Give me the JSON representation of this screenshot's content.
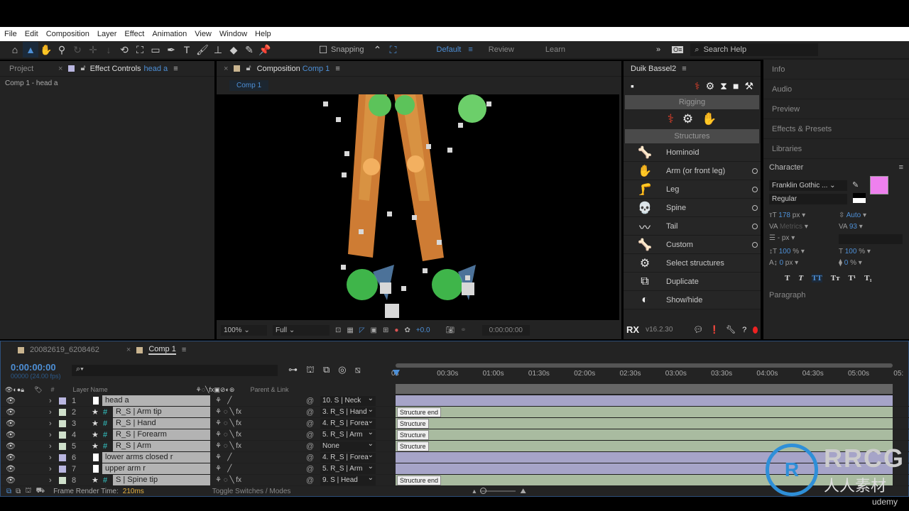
{
  "menu": [
    "File",
    "Edit",
    "Composition",
    "Layer",
    "Effect",
    "Animation",
    "View",
    "Window",
    "Help"
  ],
  "toolbar": {
    "snapping": "Snapping",
    "workspaces": [
      "Default",
      "Review",
      "Learn"
    ],
    "search_placeholder": "Search Help"
  },
  "left_panel": {
    "tabs": [
      "Project",
      "Effect Controls"
    ],
    "effect_layer": "head a",
    "subtitle": "Comp 1 - head a"
  },
  "composition": {
    "tab_label": "Composition",
    "comp_name": "Comp 1",
    "crumb": "Comp 1",
    "zoom": "100%",
    "resolution": "Full",
    "exposure": "+0.0",
    "timecode": "0:00:00:00"
  },
  "duik": {
    "title": "Duik Bassel2",
    "sections": [
      "Rigging",
      "Structures"
    ],
    "items": [
      {
        "label": "Hominoid",
        "icon": "🦴"
      },
      {
        "label": "Arm (or front leg)",
        "icon": "✋"
      },
      {
        "label": "Leg",
        "icon": "🦵"
      },
      {
        "label": "Spine",
        "icon": "💀"
      },
      {
        "label": "Tail",
        "icon": "〰"
      },
      {
        "label": "Custom",
        "icon": "🦴"
      },
      {
        "label": "Select structures",
        "icon": "⚙"
      },
      {
        "label": "Duplicate",
        "icon": "⧉"
      },
      {
        "label": "Show/hide",
        "icon": "◐"
      }
    ],
    "version": "v16.2.30",
    "logo": "RX"
  },
  "right_panels": [
    "Info",
    "Audio",
    "Preview",
    "Effects & Presets",
    "Libraries"
  ],
  "character": {
    "title": "Character",
    "font": "Franklin Gothic ...",
    "style": "Regular",
    "fill_color": "#ee80ee",
    "size": "178",
    "size_unit": "px",
    "leading": "Auto",
    "kerning": "Metrics",
    "tracking": "93",
    "stroke": "-",
    "stroke_unit": "px",
    "vscale": "100",
    "vscale_unit": "%",
    "hscale": "100",
    "hscale_unit": "%",
    "baseline": "0",
    "baseline_unit": "px",
    "tsume": "0",
    "tsume_unit": "%",
    "styles": [
      "T",
      "T",
      "TT",
      "Tт",
      "T¹",
      "T₁"
    ],
    "next": "Paragraph"
  },
  "timeline": {
    "tabs": [
      "20082619_6208462",
      "Comp 1"
    ],
    "timecode": "0:00:00:00",
    "frames": "00000 (24.00 fps)",
    "headers": {
      "name": "Layer Name",
      "parent": "Parent & Link"
    },
    "ruler": [
      "0s",
      "00:30s",
      "01:00s",
      "01:30s",
      "02:00s",
      "02:30s",
      "03:00s",
      "03:30s",
      "04:00s",
      "04:30s",
      "05:00s",
      "05:"
    ],
    "layers": [
      {
        "num": "1",
        "name": "head a",
        "parent": "10. S | Neck",
        "type": "solid",
        "color": "#b9b6e0",
        "marker": ""
      },
      {
        "num": "2",
        "name": "R_S | Arm tip",
        "parent": "3. R_S | Hand",
        "type": "structure",
        "color": "#cfe0cb",
        "marker": "Structure end"
      },
      {
        "num": "3",
        "name": "R_S | Hand",
        "parent": "4. R_S | Forea",
        "type": "structure",
        "color": "#cfe0cb",
        "marker": "Structure"
      },
      {
        "num": "4",
        "name": "R_S | Forearm",
        "parent": "5. R_S | Arm",
        "type": "structure",
        "color": "#cfe0cb",
        "marker": "Structure"
      },
      {
        "num": "5",
        "name": "R_S | Arm",
        "parent": "None",
        "type": "structure",
        "color": "#cfe0cb",
        "marker": "Structure"
      },
      {
        "num": "6",
        "name": "lower arms closed r",
        "parent": "4. R_S | Forea",
        "type": "solid",
        "color": "#b9b6e0",
        "marker": ""
      },
      {
        "num": "7",
        "name": "upper arm r",
        "parent": "5. R_S | Arm",
        "type": "solid",
        "color": "#b9b6e0",
        "marker": ""
      },
      {
        "num": "8",
        "name": "S | Spine tip",
        "parent": "9. S | Head",
        "type": "structure",
        "color": "#cfe0cb",
        "marker": "Structure end"
      }
    ],
    "render_label": "Frame Render Time:",
    "render_time": "210ms",
    "toggle": "Toggle Switches / Modes"
  },
  "watermark": {
    "text": "RRCG",
    "sub": "人人素材",
    "udemy": "udemy"
  }
}
